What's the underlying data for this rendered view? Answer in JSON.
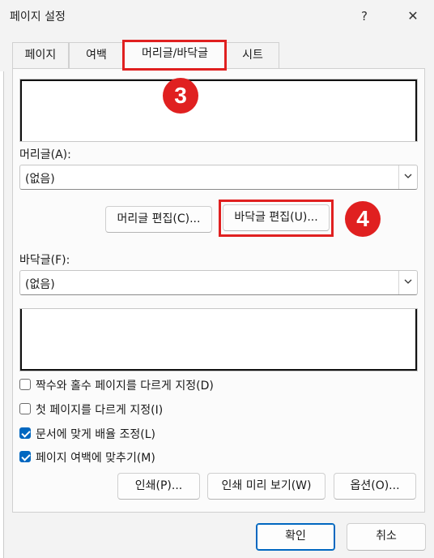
{
  "window": {
    "title": "페이지 설정",
    "help_glyph": "?",
    "close_glyph": "✕"
  },
  "tabs": [
    {
      "label": "페이지",
      "active": false
    },
    {
      "label": "여백",
      "active": false
    },
    {
      "label": "머리글/바닥글",
      "active": true
    },
    {
      "label": "시트",
      "active": false
    }
  ],
  "header": {
    "label": "머리글(A):",
    "selected": "(없음)",
    "edit_button": "머리글 편집(C)..."
  },
  "footer": {
    "label": "바닥글(F):",
    "selected": "(없음)",
    "edit_button": "바닥글 편집(U)..."
  },
  "options": [
    {
      "label": "짝수와 홀수 페이지를 다르게 지정(D)",
      "checked": false
    },
    {
      "label": "첫 페이지를 다르게 지정(I)",
      "checked": false
    },
    {
      "label": "문서에 맞게 배율 조정(L)",
      "checked": true
    },
    {
      "label": "페이지 여백에 맞추기(M)",
      "checked": true
    }
  ],
  "actions": {
    "print": "인쇄(P)...",
    "print_preview": "인쇄 미리 보기(W)",
    "options": "옵션(O)..."
  },
  "footer_buttons": {
    "ok": "확인",
    "cancel": "취소"
  },
  "annotations": {
    "step3": "3",
    "step4": "4",
    "highlight_color": "#e02020"
  },
  "colors": {
    "accent": "#0067c0"
  }
}
